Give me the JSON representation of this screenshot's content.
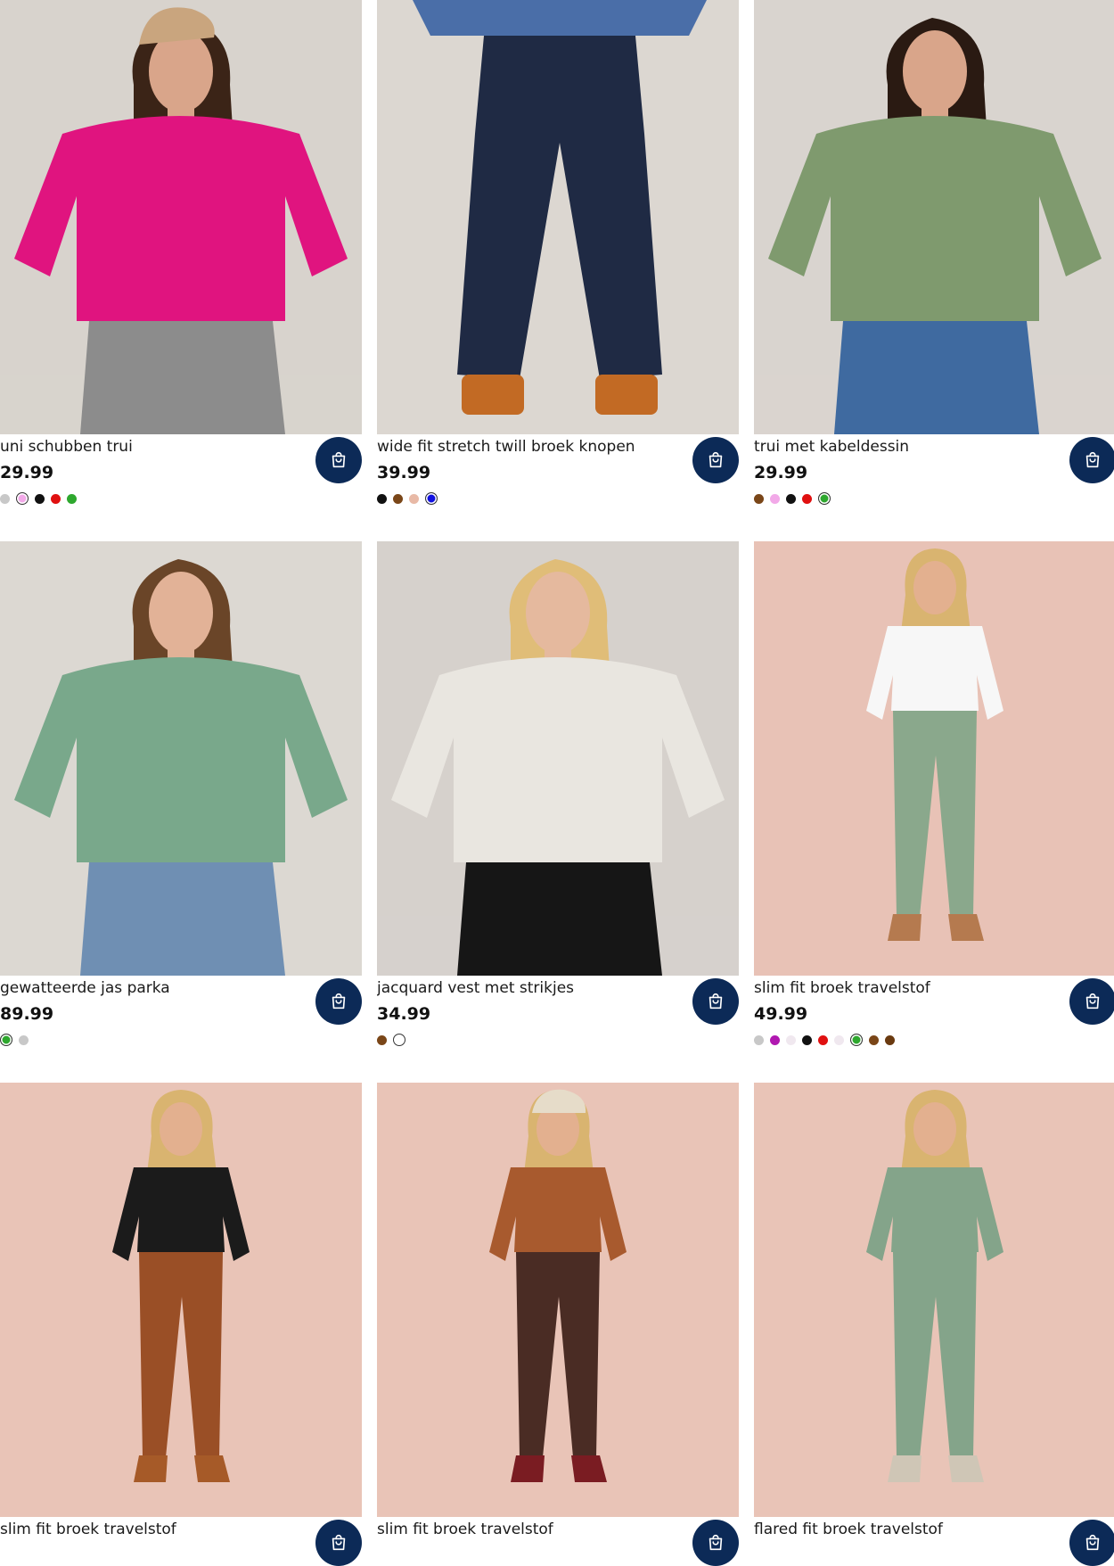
{
  "products": [
    {
      "name": "uni schubben trui",
      "price": "29.99",
      "bg": "#d8d3cd",
      "top": "#e0147f",
      "bottom": "#8c8c8c",
      "skin": "#d9a58a",
      "hair": "#3b2417",
      "hat": "#c9a57e",
      "swatches": [
        {
          "color": "#c8c8c8"
        },
        {
          "color": "#f2a9e8",
          "selected": true
        },
        {
          "color": "#111111"
        },
        {
          "color": "#e01010"
        },
        {
          "color": "#2ea82e"
        }
      ]
    },
    {
      "name": "wide fit stretch twill broek knopen",
      "price": "39.99",
      "bg": "#dcd7d1",
      "top": "#4a6ea8",
      "bottom": "#1f2a44",
      "skin": "#d9a58a",
      "hair": "#3b2417",
      "shoe": "#c26a24",
      "swatches": [
        {
          "color": "#111111"
        },
        {
          "color": "#7a4618"
        },
        {
          "color": "#e8b9a6"
        },
        {
          "color": "#1010e0",
          "selected": true
        }
      ]
    },
    {
      "name": "trui met kabeldessin",
      "price": "29.99",
      "bg": "#d9d4cf",
      "top": "#7f9a6e",
      "bottom": "#3f6aa0",
      "skin": "#d9a58a",
      "hair": "#2a1a12",
      "swatches": [
        {
          "color": "#7a4618"
        },
        {
          "color": "#f2a9e8"
        },
        {
          "color": "#111111"
        },
        {
          "color": "#e01010"
        },
        {
          "color": "#2ea82e",
          "selected": true
        }
      ]
    },
    {
      "name": "gewatteerde jas parka",
      "price": "89.99",
      "bg": "#dcd8d2",
      "top": "#79a88b",
      "bottom": "#6f8fb3",
      "skin": "#e2b297",
      "hair": "#6a4528",
      "swatches": [
        {
          "color": "#2ea82e",
          "selected": true
        },
        {
          "color": "#c8c8c8"
        }
      ]
    },
    {
      "name": "jacquard vest met strikjes",
      "price": "34.99",
      "bg": "#d6d1cc",
      "top": "#e9e6e0",
      "bottom": "#161616",
      "skin": "#e5b99e",
      "hair": "#e0bd78",
      "swatches": [
        {
          "color": "#7a4618"
        },
        {
          "color": "#ffffff",
          "hollow": true
        }
      ]
    },
    {
      "name": "slim fit broek travelstof",
      "price": "49.99",
      "bg": "#e8c2b6",
      "top": "#f7f7f7",
      "bottom": "#8aa88c",
      "skin": "#e3b08f",
      "hair": "#d9b470",
      "shoe": "#b57a4f",
      "swatches": [
        {
          "color": "#c8c8c8"
        },
        {
          "color": "#b018b0"
        },
        {
          "color": "#f0e8ef"
        },
        {
          "color": "#111111"
        },
        {
          "color": "#e01010"
        },
        {
          "color": "#f0e8ef"
        },
        {
          "color": "#2ea82e",
          "selected": true
        },
        {
          "color": "#7a4618"
        },
        {
          "color": "#6a3a10"
        }
      ]
    },
    {
      "name": "slim fit broek travelstof",
      "price": "",
      "bg": "#e9c4b7",
      "top": "#1b1b1b",
      "bottom": "#9a4f26",
      "skin": "#e3b08f",
      "hair": "#d9b470",
      "shoe": "#a65a28",
      "swatches": []
    },
    {
      "name": "slim fit broek travelstof",
      "price": "",
      "bg": "#e9c4b7",
      "top": "#a85a2e",
      "bottom": "#4a2c24",
      "skin": "#e3b08f",
      "hair": "#d9b470",
      "hat": "#e6dcc9",
      "shoe": "#7a1c22",
      "swatches": []
    },
    {
      "name": "flared fit broek travelstof",
      "price": "",
      "bg": "#e9c4b7",
      "top": "#84a48a",
      "bottom": "#84a48a",
      "skin": "#e3b08f",
      "hair": "#d9b470",
      "shoe": "#cfc6b6",
      "swatches": []
    }
  ]
}
